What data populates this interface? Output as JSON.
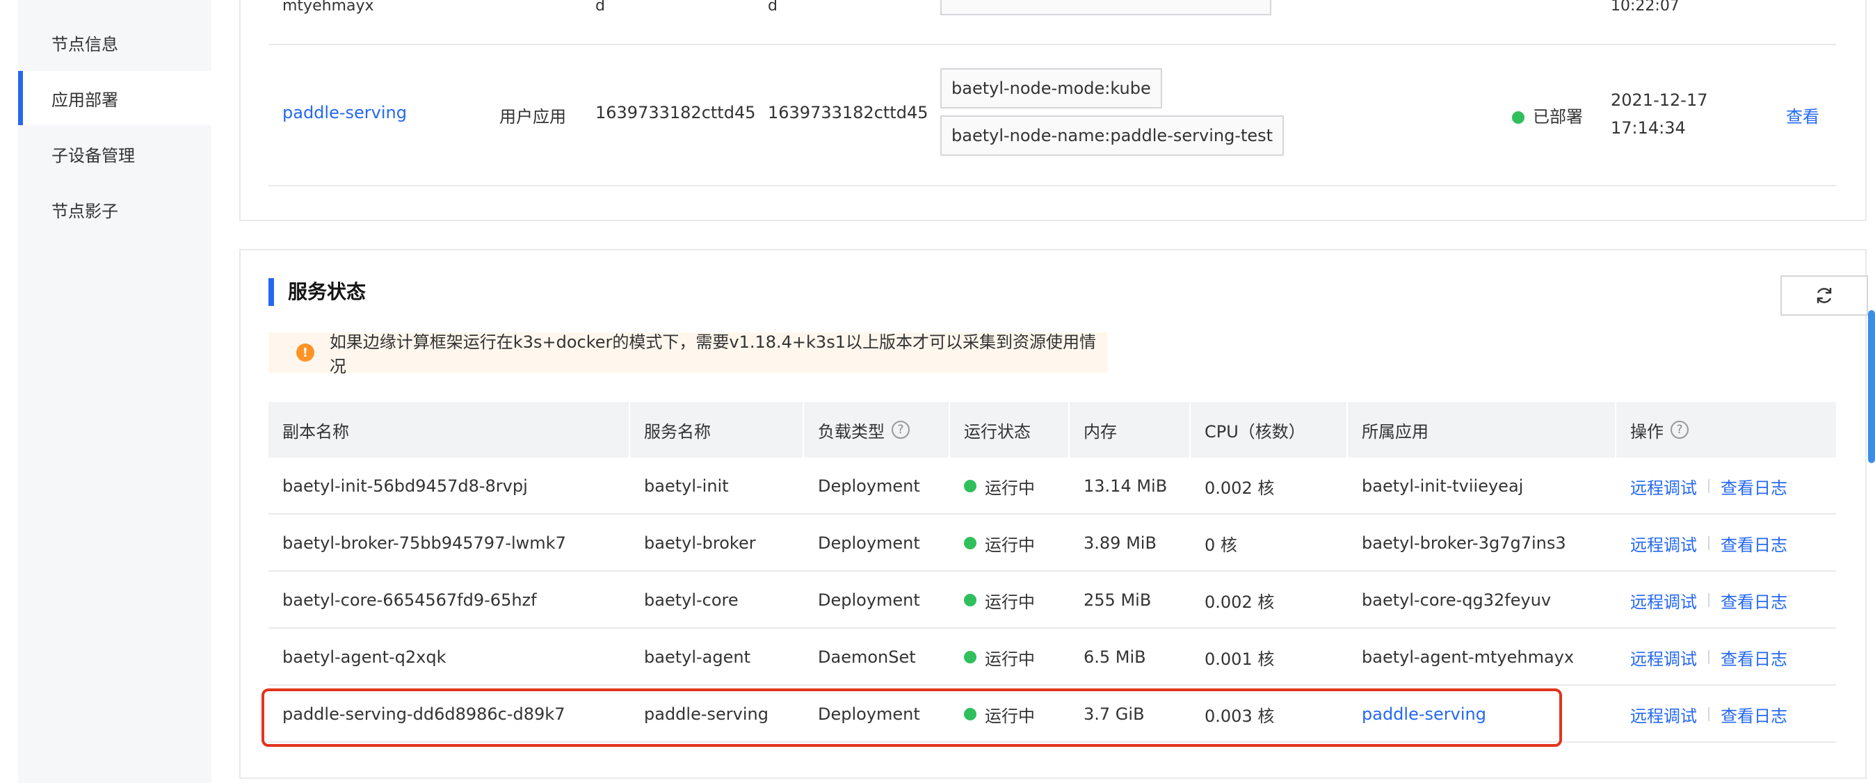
{
  "sidebar": {
    "items": [
      {
        "label": "节点信息"
      },
      {
        "label": "应用部署"
      },
      {
        "label": "子设备管理"
      },
      {
        "label": "节点影子"
      }
    ]
  },
  "top_table": {
    "cut_row": {
      "name": "mtyehmayx",
      "col3": "d",
      "col4": "d",
      "time": "10:22:07"
    },
    "row": {
      "name": "paddle-serving",
      "type": "用户应用",
      "version": "1639733182cttd45",
      "version2": "1639733182cttd45",
      "tags": [
        "baetyl-node-mode:kube",
        "baetyl-node-name:paddle-serving-test"
      ],
      "status": "已部署",
      "date": "2021-12-17",
      "time": "17:14:34",
      "action": "查看"
    }
  },
  "service_status": {
    "title": "服务状态",
    "notice": "如果边缘计算框架运行在k3s+docker的模式下，需要v1.18.4+k3s1以上版本才可以采集到资源使用情况",
    "warn_icon": "!",
    "refresh_icon": "refresh-icon",
    "columns": [
      "副本名称",
      "服务名称",
      "负载类型",
      "运行状态",
      "内存",
      "CPU（核数）",
      "所属应用",
      "操作"
    ],
    "help_glyph": "?",
    "rows": [
      {
        "replica": "baetyl-init-56bd9457d8-8rvpj",
        "service": "baetyl-init",
        "load": "Deployment",
        "status": "运行中",
        "memory": "13.14 MiB",
        "cpu": "0.002 核",
        "app": "baetyl-init-tviieyeaj",
        "op1": "远程调试",
        "op2": "查看日志"
      },
      {
        "replica": "baetyl-broker-75bb945797-lwmk7",
        "service": "baetyl-broker",
        "load": "Deployment",
        "status": "运行中",
        "memory": "3.89 MiB",
        "cpu": "0 核",
        "app": "baetyl-broker-3g7g7ins3",
        "op1": "远程调试",
        "op2": "查看日志"
      },
      {
        "replica": "baetyl-core-6654567fd9-65hzf",
        "service": "baetyl-core",
        "load": "Deployment",
        "status": "运行中",
        "memory": "255 MiB",
        "cpu": "0.002 核",
        "app": "baetyl-core-qg32feyuv",
        "op1": "远程调试",
        "op2": "查看日志"
      },
      {
        "replica": "baetyl-agent-q2xqk",
        "service": "baetyl-agent",
        "load": "DaemonSet",
        "status": "运行中",
        "memory": "6.5 MiB",
        "cpu": "0.001 核",
        "app": "baetyl-agent-mtyehmayx",
        "op1": "远程调试",
        "op2": "查看日志"
      },
      {
        "replica": "paddle-serving-dd6d8986c-d89k7",
        "service": "paddle-serving",
        "load": "Deployment",
        "status": "运行中",
        "memory": "3.7 GiB",
        "cpu": "0.003 核",
        "app": "paddle-serving",
        "op1": "远程调试",
        "op2": "查看日志"
      }
    ]
  },
  "colors": {
    "accent": "#2468f2",
    "success": "#30bf5d",
    "warning": "#ff9326",
    "highlight": "#e2341d"
  }
}
